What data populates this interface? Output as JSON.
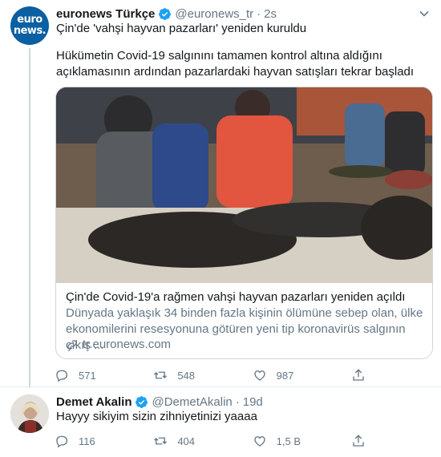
{
  "tweet1": {
    "name": "euronews Türkçe",
    "handle": "@euronews_tr",
    "dot": "·",
    "time": "2s",
    "text_line1": "Çin'de 'vahşi hayvan pazarları' yeniden kuruldu",
    "text_body": "Hükümetin Covid-19 salgınını tamamen kontrol altına aldığını açıklamasının ardından pazarlardaki hayvan satışları tekrar başladı",
    "avatar_text_line1": "euro",
    "avatar_text_line2": "news.",
    "card": {
      "title": "Çin'de Covid-19'a rağmen vahşi hayvan pazarları yeniden açıldı",
      "description": "Dünyada yaklaşık 34 binden fazla kişinin ölümüne sebep olan, ülke ekonomilerini resesyonuna götüren yeni tip koronavirüs salgının çıkış ...",
      "domain": "tr.euronews.com"
    },
    "actions": {
      "reply_count": "571",
      "retweet_count": "548",
      "like_count": "987"
    }
  },
  "tweet2": {
    "name": "Demet Akalin",
    "handle": "@DemetAkalin",
    "dot": "·",
    "time": "19d",
    "text": "Hayyy sikiyim sizin zihniyetinizi yaaaa",
    "actions": {
      "reply_count": "116",
      "retweet_count": "404",
      "like_count": "1,5 B"
    }
  },
  "colors": {
    "accent": "#1da1f2",
    "secondary_text": "#657786",
    "border": "#ccd6dd",
    "avatar_brand": "#0b5fa3"
  },
  "icons": [
    "verified-icon",
    "caret-down-icon",
    "link-icon",
    "reply-icon",
    "retweet-icon",
    "like-icon",
    "share-icon"
  ]
}
